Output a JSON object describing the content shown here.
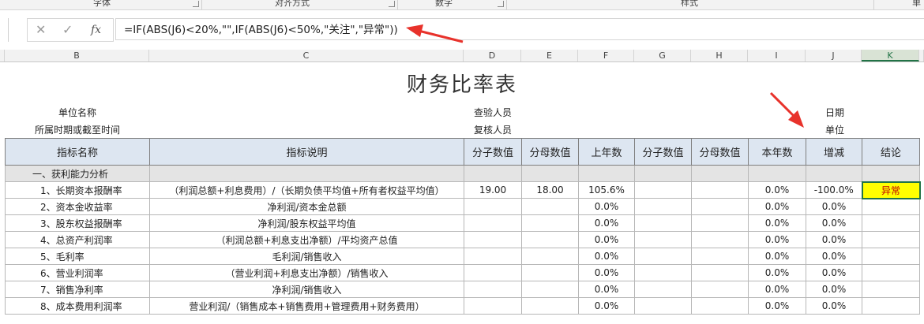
{
  "ribbon": {
    "groups": [
      "字体",
      "对齐方式",
      "数字",
      "样式",
      "单"
    ]
  },
  "formula_bar": {
    "cancel_icon": "x-icon",
    "enter_icon": "check-icon",
    "function_label": "fx",
    "formula": "=IF(ABS(J6)<20%,\"\",IF(ABS(J6)<50%,\"关注\",\"异常\"))"
  },
  "columns": [
    "B",
    "C",
    "D",
    "E",
    "F",
    "G",
    "H",
    "I",
    "J",
    "K"
  ],
  "selected_column": "K",
  "sheet": {
    "title": "财务比率表",
    "meta": {
      "unit_name_label": "单位名称",
      "period_label": "所属时期或截至时间",
      "checker_label": "查验人员",
      "reviewer_label": "复核人员",
      "date_label": "日期",
      "unit_label": "单位"
    },
    "headers": [
      "指标名称",
      "指标说明",
      "分子数值",
      "分母数值",
      "上年数",
      "分子数值",
      "分母数值",
      "本年数",
      "增减",
      "结论"
    ],
    "section": "一、获利能力分析",
    "rows": [
      {
        "name": "1、长期资本报酬率",
        "desc": "（利润总额+利息费用）/（长期负债平均值+所有者权益平均值）",
        "num1": "19.00",
        "den1": "18.00",
        "prev": "105.6%",
        "num2": "",
        "den2": "",
        "curr": "0.0%",
        "change": "-100.0%",
        "conclusion": "异常"
      },
      {
        "name": "2、资本金收益率",
        "desc": "净利润/资本金总额",
        "num1": "",
        "den1": "",
        "prev": "0.0%",
        "num2": "",
        "den2": "",
        "curr": "0.0%",
        "change": "0.0%",
        "conclusion": ""
      },
      {
        "name": "3、股东权益报酬率",
        "desc": "净利润/股东权益平均值",
        "num1": "",
        "den1": "",
        "prev": "0.0%",
        "num2": "",
        "den2": "",
        "curr": "0.0%",
        "change": "0.0%",
        "conclusion": ""
      },
      {
        "name": "4、总资产利润率",
        "desc": "（利润总额+利息支出净额）/平均资产总值",
        "num1": "",
        "den1": "",
        "prev": "0.0%",
        "num2": "",
        "den2": "",
        "curr": "0.0%",
        "change": "0.0%",
        "conclusion": ""
      },
      {
        "name": "5、毛利率",
        "desc": "毛利润/销售收入",
        "num1": "",
        "den1": "",
        "prev": "0.0%",
        "num2": "",
        "den2": "",
        "curr": "0.0%",
        "change": "0.0%",
        "conclusion": ""
      },
      {
        "name": "6、营业利润率",
        "desc": "（营业利润+利息支出净额）/销售收入",
        "num1": "",
        "den1": "",
        "prev": "0.0%",
        "num2": "",
        "den2": "",
        "curr": "0.0%",
        "change": "0.0%",
        "conclusion": ""
      },
      {
        "name": "7、销售净利率",
        "desc": "净利润/销售收入",
        "num1": "",
        "den1": "",
        "prev": "0.0%",
        "num2": "",
        "den2": "",
        "curr": "0.0%",
        "change": "0.0%",
        "conclusion": ""
      },
      {
        "name": "8、成本费用利润率",
        "desc": "营业利润/（销售成本+销售费用+管理费用+财务费用）",
        "num1": "",
        "den1": "",
        "prev": "0.0%",
        "num2": "",
        "den2": "",
        "curr": "0.0%",
        "change": "0.0%",
        "conclusion": ""
      }
    ]
  },
  "colors": {
    "header_fill": "#dde6f1",
    "section_fill": "#e4e4e4",
    "alert_fill": "#ffff00",
    "alert_text": "#c00000",
    "arrow": "#e8322b",
    "excel_green": "#217346"
  }
}
